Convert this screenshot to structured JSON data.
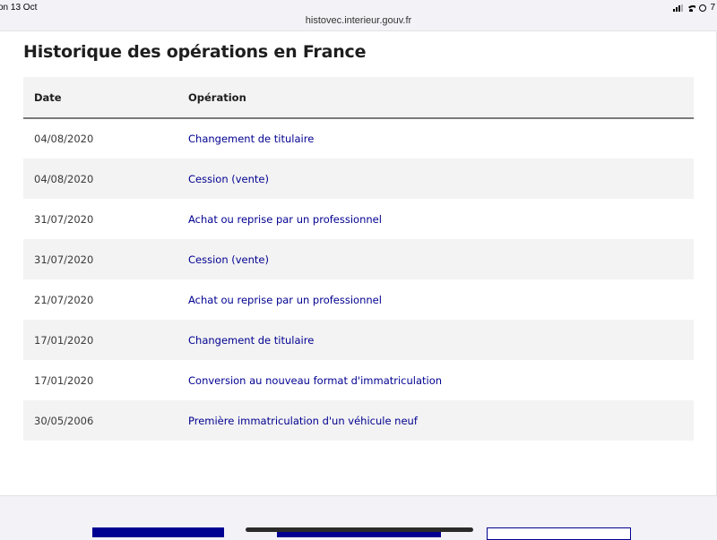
{
  "statusbar": {
    "time": "on 13 Oct",
    "battery": "7"
  },
  "browser": {
    "url": "histovec.interieur.gouv.fr"
  },
  "section": {
    "title": "Historique des opérations en France",
    "columns": [
      "Date",
      "Opération"
    ],
    "rows": [
      {
        "date": "04/08/2020",
        "operation": "Changement de titulaire"
      },
      {
        "date": "04/08/2020",
        "operation": "Cession (vente)"
      },
      {
        "date": "31/07/2020",
        "operation": "Achat ou reprise par un professionnel"
      },
      {
        "date": "31/07/2020",
        "operation": "Cession (vente)"
      },
      {
        "date": "21/07/2020",
        "operation": "Achat ou reprise par un professionnel"
      },
      {
        "date": "17/01/2020",
        "operation": "Changement de titulaire"
      },
      {
        "date": "17/01/2020",
        "operation": "Conversion au nouveau format d'immatriculation"
      },
      {
        "date": "30/05/2006",
        "operation": "Première immatriculation d'un véhicule neuf"
      }
    ]
  },
  "colors": {
    "accent": "#000091",
    "row_alt": "#f3f3f3",
    "text": "#1e1e1e"
  }
}
